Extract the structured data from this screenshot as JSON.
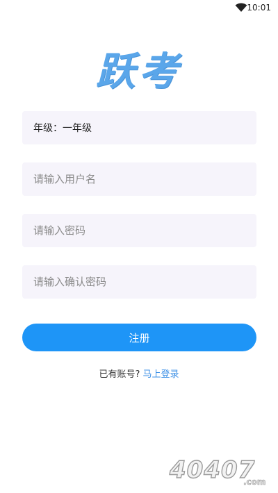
{
  "status_bar": {
    "time": "10:01",
    "wifi_icon": "wifi-icon"
  },
  "logo": {
    "text": "跃考",
    "color": "#5aa6ea"
  },
  "form": {
    "grade_label": "年级：一年级",
    "username_placeholder": "请输入用户名",
    "password_placeholder": "请输入密码",
    "confirm_password_placeholder": "请输入确认密码",
    "register_label": "注册"
  },
  "footer": {
    "have_account": "已有账号? ",
    "login_link": "马上登录"
  },
  "watermark": {
    "text": "40407",
    "suffix": ".com"
  },
  "colors": {
    "accent": "#1e95f7",
    "field_bg": "#f6f4fb",
    "link": "#3b8fe6"
  }
}
